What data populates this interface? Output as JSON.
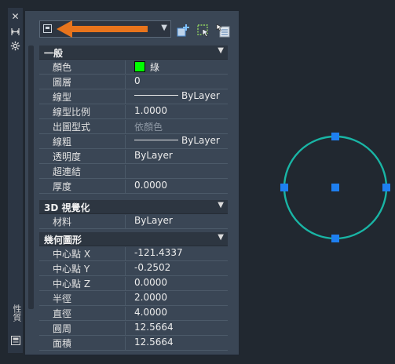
{
  "side_bar": {
    "title": "性質",
    "close_icon": "close-icon",
    "pin_icon": "autohide-icon",
    "settings_icon": "gear-icon",
    "palette_icon": "properties-palette-icon"
  },
  "toolbar": {
    "selector_value": "",
    "icons": [
      "toggle-pickadd-icon",
      "select-objects-icon",
      "quick-select-icon"
    ]
  },
  "annotation": {
    "arrow_color": "#e8741c"
  },
  "sections": [
    {
      "title": "一般",
      "rows": [
        {
          "label": "顏色",
          "value": "綠",
          "swatch": "#00ff00"
        },
        {
          "label": "圖層",
          "value": "0"
        },
        {
          "label": "線型",
          "value": "ByLayer",
          "line": true
        },
        {
          "label": "線型比例",
          "value": "1.0000"
        },
        {
          "label": "出圖型式",
          "value": "依顏色",
          "dim": true
        },
        {
          "label": "線粗",
          "value": "ByLayer",
          "line": true
        },
        {
          "label": "透明度",
          "value": "ByLayer"
        },
        {
          "label": "超連結",
          "value": ""
        },
        {
          "label": "厚度",
          "value": "0.0000"
        }
      ]
    },
    {
      "title": "3D 視覺化",
      "rows": [
        {
          "label": "材料",
          "value": "ByLayer"
        }
      ]
    },
    {
      "title": "幾何圖形",
      "rows": [
        {
          "label": "中心點 X",
          "value": "-121.4337"
        },
        {
          "label": "中心點 Y",
          "value": "-0.2502"
        },
        {
          "label": "中心點 Z",
          "value": "0.0000"
        },
        {
          "label": "半徑",
          "value": "2.0000"
        },
        {
          "label": "直徑",
          "value": "4.0000"
        },
        {
          "label": "圓周",
          "value": "12.5664"
        },
        {
          "label": "面積",
          "value": "12.5664"
        }
      ]
    }
  ],
  "drawing": {
    "circle_color": "#19b5a5",
    "grip_color": "#1e7ff0"
  }
}
